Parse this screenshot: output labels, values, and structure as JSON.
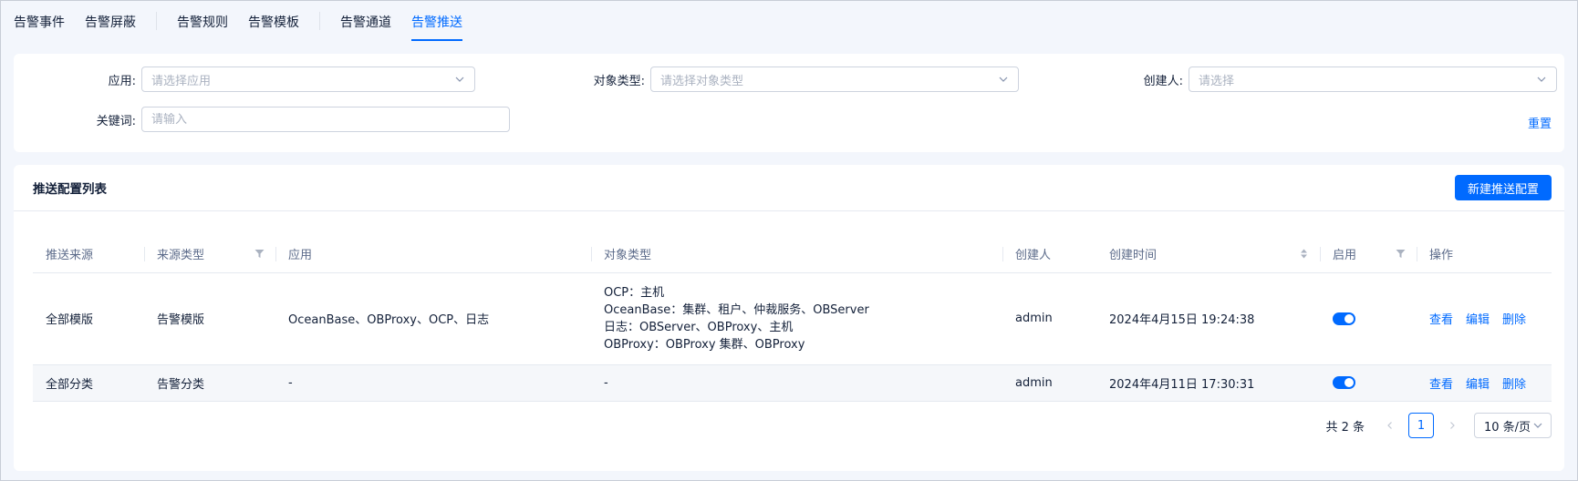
{
  "tabs": [
    {
      "label": "告警事件"
    },
    {
      "label": "告警屏蔽"
    },
    {
      "label": "告警规则"
    },
    {
      "label": "告警模板"
    },
    {
      "label": "告警通道"
    },
    {
      "label": "告警推送",
      "active": true
    }
  ],
  "filters": {
    "app": {
      "label": "应用:",
      "placeholder": "请选择应用"
    },
    "object_type": {
      "label": "对象类型:",
      "placeholder": "请选择对象类型"
    },
    "creator": {
      "label": "创建人:",
      "placeholder": "请选择"
    },
    "keyword": {
      "label": "关键词:",
      "placeholder": "请输入"
    },
    "reset_label": "重置"
  },
  "list": {
    "title": "推送配置列表",
    "new_button": "新建推送配置",
    "columns": {
      "source": "推送来源",
      "source_type": "来源类型",
      "app": "应用",
      "object_type": "对象类型",
      "creator": "创建人",
      "created_at": "创建时间",
      "enabled": "启用",
      "actions": "操作"
    },
    "rows": [
      {
        "source": "全部模版",
        "source_type": "告警模版",
        "app": "OceanBase、OBProxy、OCP、日志",
        "object_types": [
          "OCP：主机",
          "OceanBase：集群、租户、仲裁服务、OBServer",
          "日志：OBServer、OBProxy、主机",
          "OBProxy：OBProxy 集群、OBProxy"
        ],
        "creator": "admin",
        "created_at": "2024年4月15日 19:24:38",
        "enabled": true
      },
      {
        "source": "全部分类",
        "source_type": "告警分类",
        "app": "-",
        "object_types": [
          "-"
        ],
        "creator": "admin",
        "created_at": "2024年4月11日 17:30:31",
        "enabled": true
      }
    ],
    "actions": {
      "view": "查看",
      "edit": "编辑",
      "delete": "删除"
    }
  },
  "pagination": {
    "total_label": "共 2 条",
    "current_page": "1",
    "page_size_label": "10 条/页"
  },
  "colors": {
    "accent": "#006aff",
    "text": "#132039",
    "muted": "#5c6b8a"
  }
}
